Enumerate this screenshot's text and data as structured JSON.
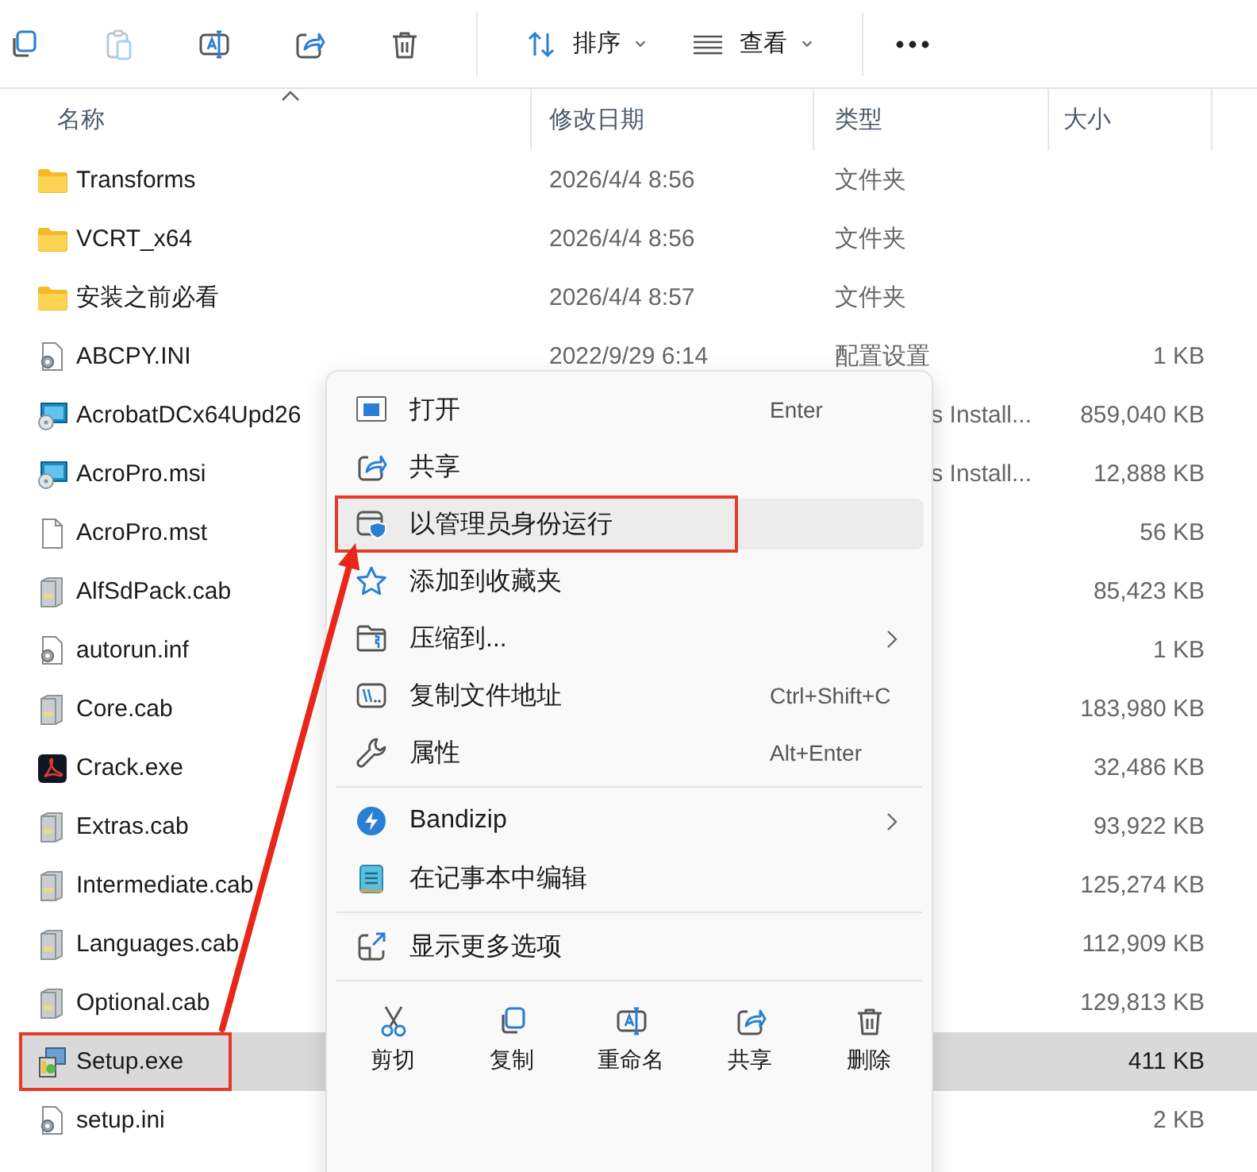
{
  "toolbar": {
    "buttons": [
      {
        "kind": "copy",
        "disabled": false
      },
      {
        "kind": "paste",
        "disabled": true
      },
      {
        "kind": "rename",
        "disabled": false
      },
      {
        "kind": "share",
        "disabled": false
      },
      {
        "kind": "delete",
        "disabled": false
      }
    ],
    "sort": {
      "label": "排序"
    },
    "view": {
      "label": "查看"
    }
  },
  "columns": [
    {
      "label": "名称",
      "sorted": true
    },
    {
      "label": "修改日期",
      "sorted": false
    },
    {
      "label": "类型",
      "sorted": false
    },
    {
      "label": "大小",
      "sorted": false
    }
  ],
  "rows": [
    {
      "kind": "folder",
      "name": "Transforms",
      "date": "2026/4/4 8:56",
      "type": "文件夹",
      "selected": false,
      "outlined": false
    },
    {
      "kind": "folder",
      "name": "VCRT_x64",
      "date": "2026/4/4 8:56",
      "type": "文件夹",
      "selected": false,
      "outlined": false
    },
    {
      "kind": "folder",
      "name": "安装之前必看",
      "date": "2026/4/4 8:57",
      "type": "文件夹",
      "selected": false,
      "outlined": false
    },
    {
      "kind": "settings-file",
      "name": "ABCPY.INI",
      "date": "2022/9/29 6:14",
      "type": "配置设置",
      "size": "1 KB",
      "selected": false,
      "outlined": false
    },
    {
      "kind": "installer",
      "name": "AcrobatDCx64Upd26",
      "type_fragment": "s Install...",
      "size": "859,040 KB",
      "selected": false,
      "outlined": false
    },
    {
      "kind": "installer",
      "name": "AcroPro.msi",
      "type_fragment": "s Install...",
      "size": "12,888 KB",
      "selected": false,
      "outlined": false
    },
    {
      "kind": "document",
      "name": "AcroPro.mst",
      "size": "56 KB",
      "selected": false,
      "outlined": false
    },
    {
      "kind": "archive",
      "name": "AlfSdPack.cab",
      "size": "85,423 KB",
      "selected": false,
      "outlined": false
    },
    {
      "kind": "settings-file",
      "name": "autorun.inf",
      "size": "1 KB",
      "selected": false,
      "outlined": false
    },
    {
      "kind": "archive",
      "name": "Core.cab",
      "size": "183,980 KB",
      "selected": false,
      "outlined": false
    },
    {
      "kind": "pdf-app",
      "name": "Crack.exe",
      "size": "32,486 KB",
      "selected": false,
      "outlined": false
    },
    {
      "kind": "archive",
      "name": "Extras.cab",
      "size": "93,922 KB",
      "selected": false,
      "outlined": false
    },
    {
      "kind": "archive",
      "name": "Intermediate.cab",
      "size": "125,274 KB",
      "selected": false,
      "outlined": false
    },
    {
      "kind": "archive",
      "name": "Languages.cab",
      "size": "112,909 KB",
      "selected": false,
      "outlined": false
    },
    {
      "kind": "archive",
      "name": "Optional.cab",
      "size": "129,813 KB",
      "selected": false,
      "outlined": false
    },
    {
      "kind": "setup-app",
      "name": "Setup.exe",
      "size": "411 KB",
      "selected": true,
      "outlined": true
    },
    {
      "kind": "settings-file",
      "name": "setup.ini",
      "size": "2 KB",
      "selected": false,
      "outlined": false
    }
  ],
  "context_menu": {
    "groups": [
      [
        {
          "kind": "open",
          "label": "打开",
          "shortcut": "Enter",
          "submenu": false,
          "selected": false,
          "outlined": false
        },
        {
          "kind": "share",
          "label": "共享",
          "submenu": false,
          "selected": false,
          "outlined": false
        },
        {
          "kind": "admin",
          "label": "以管理员身份运行",
          "submenu": false,
          "selected": true,
          "outlined": true
        },
        {
          "kind": "favorite",
          "label": "添加到收藏夹",
          "submenu": false,
          "selected": false,
          "outlined": false
        },
        {
          "kind": "compress",
          "label": "压缩到...",
          "submenu": true,
          "selected": false,
          "outlined": false
        },
        {
          "kind": "copy-path",
          "label": "复制文件地址",
          "shortcut": "Ctrl+Shift+C",
          "submenu": false,
          "selected": false,
          "outlined": false
        },
        {
          "kind": "properties",
          "label": "属性",
          "shortcut": "Alt+Enter",
          "submenu": false,
          "selected": false,
          "outlined": false
        }
      ],
      [
        {
          "kind": "bandizip",
          "label": "Bandizip",
          "submenu": true,
          "selected": false,
          "outlined": false
        },
        {
          "kind": "notepad",
          "label": "在记事本中编辑",
          "submenu": false,
          "selected": false,
          "outlined": false
        }
      ],
      [
        {
          "kind": "more",
          "label": "显示更多选项",
          "submenu": false,
          "selected": false,
          "outlined": false
        }
      ]
    ],
    "actions": [
      {
        "kind": "cut",
        "label": "剪切"
      },
      {
        "kind": "copy",
        "label": "复制"
      },
      {
        "kind": "rename",
        "label": "重命名"
      },
      {
        "kind": "share",
        "label": "共享"
      },
      {
        "kind": "delete",
        "label": "删除"
      }
    ]
  },
  "annotation_arrow": true
}
